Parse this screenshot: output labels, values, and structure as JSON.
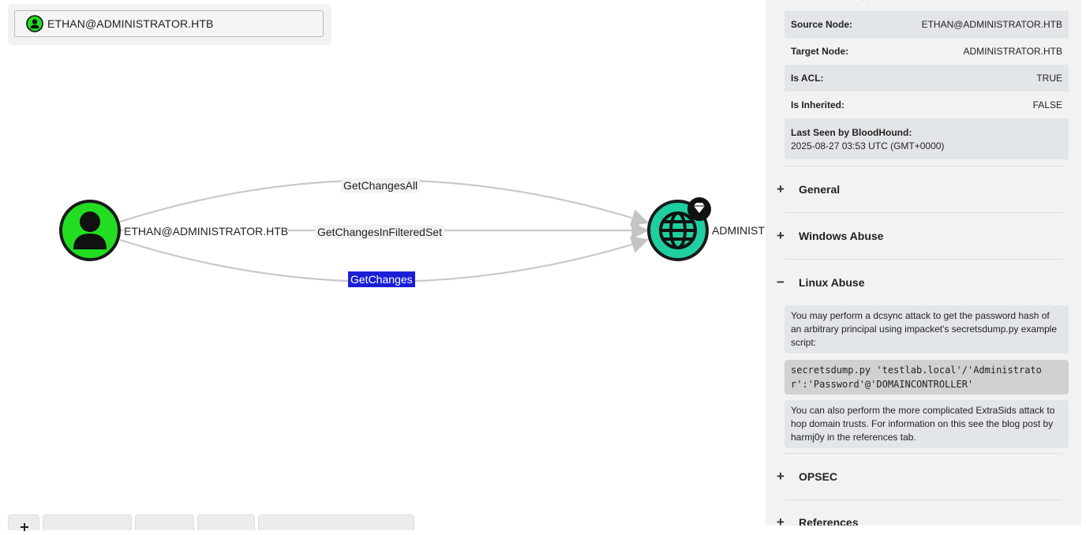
{
  "search": {
    "value": "ETHAN@ADMINISTRATOR.HTB",
    "icon": "user-icon"
  },
  "graph": {
    "source_node": {
      "label": "ETHAN@ADMINISTRATOR.HTB",
      "icon": "user-icon",
      "color": "#22dd22"
    },
    "target_node": {
      "label": "ADMINIST",
      "icon": "globe-icon",
      "color": "#1fcf9f",
      "badge_icon": "gem-icon"
    },
    "edges": [
      {
        "label": "GetChangesAll",
        "selected": false
      },
      {
        "label": "GetChangesInFilteredSet",
        "selected": false
      },
      {
        "label": "GetChanges",
        "selected": true
      }
    ],
    "selected_edge_color": "#1a1fd6"
  },
  "panel": {
    "properties": {
      "source_node_key": "Source Node:",
      "source_node_val": "ETHAN@ADMINISTRATOR.HTB",
      "target_node_key": "Target Node:",
      "target_node_val": "ADMINISTRATOR.HTB",
      "is_acl_key": "Is ACL:",
      "is_acl_val": "TRUE",
      "is_inherited_key": "Is Inherited:",
      "is_inherited_val": "FALSE",
      "last_seen_key": "Last Seen by BloodHound:",
      "last_seen_val": "2025-08-27 03:53 UTC (GMT+0000)"
    },
    "sections": {
      "general": {
        "label": "General",
        "sign": "+"
      },
      "windows_abuse": {
        "label": "Windows Abuse",
        "sign": "+"
      },
      "linux_abuse": {
        "label": "Linux Abuse",
        "sign": "−"
      },
      "opsec": {
        "label": "OPSEC",
        "sign": "+"
      },
      "references": {
        "label": "References",
        "sign": "+"
      }
    },
    "linux_abuse": {
      "text1": "You may perform a dcsync attack to get the password hash of an arbitrary principal using impacket's secretsdump.py example script:",
      "code": "secretsdump.py 'testlab.local'/'Administrator':'Password'@'DOMAINCONTROLLER'",
      "text2": "You can also perform the more complicated ExtraSids attack to hop domain trusts. For information on this see the blog post by harmj0y in the references tab."
    }
  }
}
